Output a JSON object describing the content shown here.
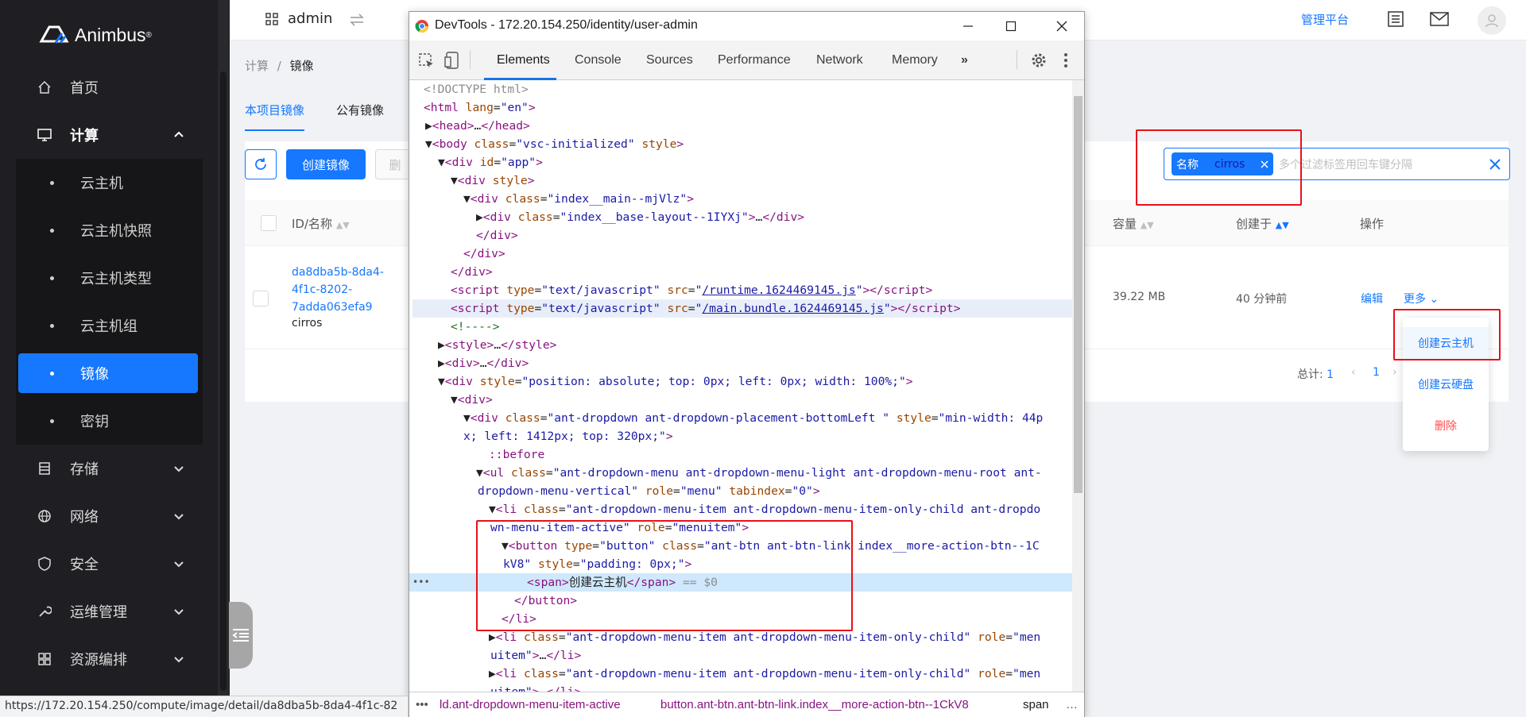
{
  "app": {
    "logo_text": "Animbus",
    "logo_mark": "®"
  },
  "sidebar": {
    "items": [
      {
        "label": "首页",
        "icon": "home-icon"
      },
      {
        "label": "计算",
        "icon": "desktop-icon",
        "expanded": true
      },
      {
        "label": "存储",
        "icon": "storage-icon"
      },
      {
        "label": "网络",
        "icon": "globe-icon"
      },
      {
        "label": "安全",
        "icon": "shield-icon"
      },
      {
        "label": "运维管理",
        "icon": "wrench-icon"
      },
      {
        "label": "资源编排",
        "icon": "grid-icon"
      }
    ],
    "compute_sub": [
      "云主机",
      "云主机快照",
      "云主机类型",
      "云主机组",
      "镜像",
      "密钥"
    ],
    "active_sub": "镜像"
  },
  "topbar": {
    "user": "admin",
    "platform_link": "管理平台"
  },
  "breadcrumb": {
    "parent": "计算",
    "separator": "/",
    "current": "镜像"
  },
  "tabs": [
    "本项目镜像",
    "公有镜像"
  ],
  "toolbar": {
    "create_label": "创建镜像",
    "delete_label": "删"
  },
  "search": {
    "tag_key": "名称",
    "tag_value": "cirros",
    "placeholder": "多个过滤标签用回车键分隔"
  },
  "table": {
    "headers": {
      "id_name": "ID/名称",
      "size": "容量",
      "created": "创建于",
      "actions": "操作"
    },
    "row": {
      "id_lines": [
        "da8dba5b-8da4-",
        "4f1c-8202-",
        "7adda063efa9"
      ],
      "name": "cirros",
      "size": "39.22 MB",
      "created": "40 分钟前",
      "edit": "编辑",
      "more": "更多"
    }
  },
  "pagination": {
    "total_label": "总计:",
    "total": "1",
    "page": "1"
  },
  "dropdown": {
    "items": [
      "创建云主机",
      "创建云硬盘",
      "删除"
    ]
  },
  "devtools": {
    "title": "DevTools - 172.20.154.250/identity/user-admin",
    "tabs": [
      "Elements",
      "Console",
      "Sources",
      "Performance",
      "Network",
      "Memory",
      "»"
    ],
    "active_tab": "Elements",
    "crumbs": [
      "ld.ant-dropdown-menu-item-active",
      "button.ant-btn.ant-btn-link.index__more-action-btn--1CkV8",
      "span"
    ],
    "selected_marker": "== $0"
  },
  "status_url": "https://172.20.154.250/compute/image/detail/da8dba5b-8da4-4f1c-82"
}
